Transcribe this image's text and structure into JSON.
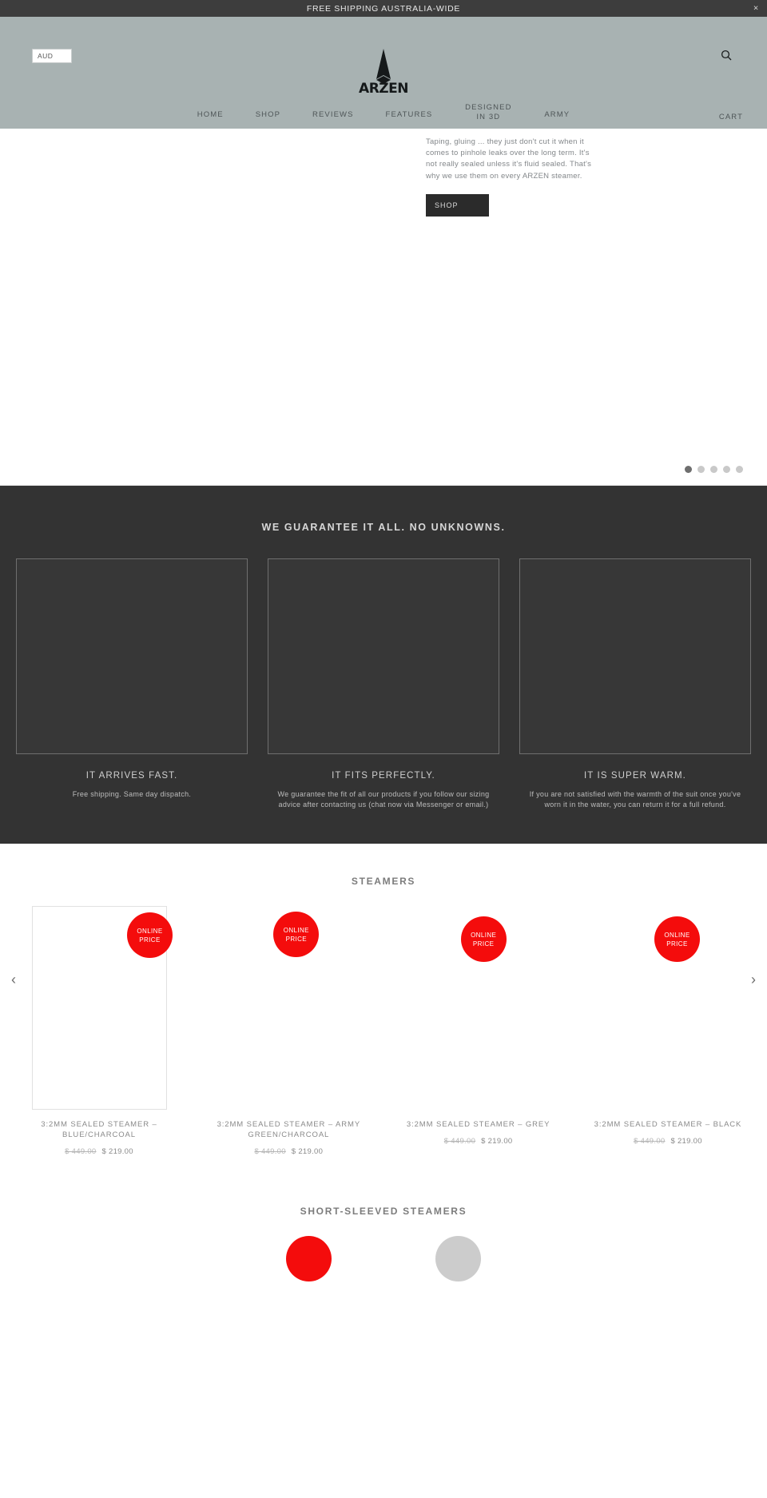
{
  "announcement": {
    "text": "FREE SHIPPING AUSTRALIA-WIDE",
    "close_icon": "×"
  },
  "header": {
    "currency": "AUD",
    "logo": "ARZEN",
    "search_icon": "search-icon",
    "cart_label": "CART",
    "nav": [
      {
        "label": "HOME"
      },
      {
        "label": "SHOP"
      },
      {
        "label": "REVIEWS"
      },
      {
        "label": "FEATURES"
      },
      {
        "label": "DESIGNED IN 3D"
      },
      {
        "label": "ARMY"
      }
    ]
  },
  "hero": {
    "body": "Taping, gluing ... they just don't cut it when it comes to pinhole leaks over the long term. It's not really sealed unless it's fluid sealed. That's why we use them on every ARZEN steamer.",
    "cta": "SHOP",
    "slides_total": 5,
    "active_slide": 1
  },
  "guarantee": {
    "title": "WE GUARANTEE IT ALL. NO UNKNOWNS.",
    "columns": [
      {
        "heading": "IT ARRIVES FAST.",
        "body": "Free shipping. Same day dispatch."
      },
      {
        "heading": "IT FITS PERFECTLY.",
        "body": "We guarantee the fit of all our products if you follow our sizing advice after contacting us (chat now via Messenger or email.)"
      },
      {
        "heading": "IT IS SUPER WARM.",
        "body": "If you are not satisfied with the warmth of the suit once you've worn it in the water, you can return it for a full refund."
      }
    ]
  },
  "steamers": {
    "title": "STEAMERS",
    "prev_arrow": "‹",
    "next_arrow": "›",
    "badge_line1": "ONLINE",
    "badge_line2": "PRICE",
    "products": [
      {
        "title": "3:2MM SEALED STEAMER – BLUE/CHARCOAL",
        "old_price": "$ 449.00",
        "price": "$ 219.00"
      },
      {
        "title": "3:2MM SEALED STEAMER – ARMY GREEN/CHARCOAL",
        "old_price": "$ 449.00",
        "price": "$ 219.00"
      },
      {
        "title": "3:2MM SEALED STEAMER – GREY",
        "old_price": "$ 449.00",
        "price": "$ 219.00"
      },
      {
        "title": "3:2MM SEALED STEAMER – BLACK",
        "old_price": "$ 449.00",
        "price": "$ 219.00"
      }
    ]
  },
  "short_sleeved": {
    "title": "SHORT-SLEEVED STEAMERS"
  },
  "colors": {
    "announcement_bg": "#3d3d3d",
    "header_bg": "#a8b2b2",
    "dark_section_bg": "#333333",
    "badge_red": "#f40c0c",
    "button_dark": "#2b2b2b"
  }
}
